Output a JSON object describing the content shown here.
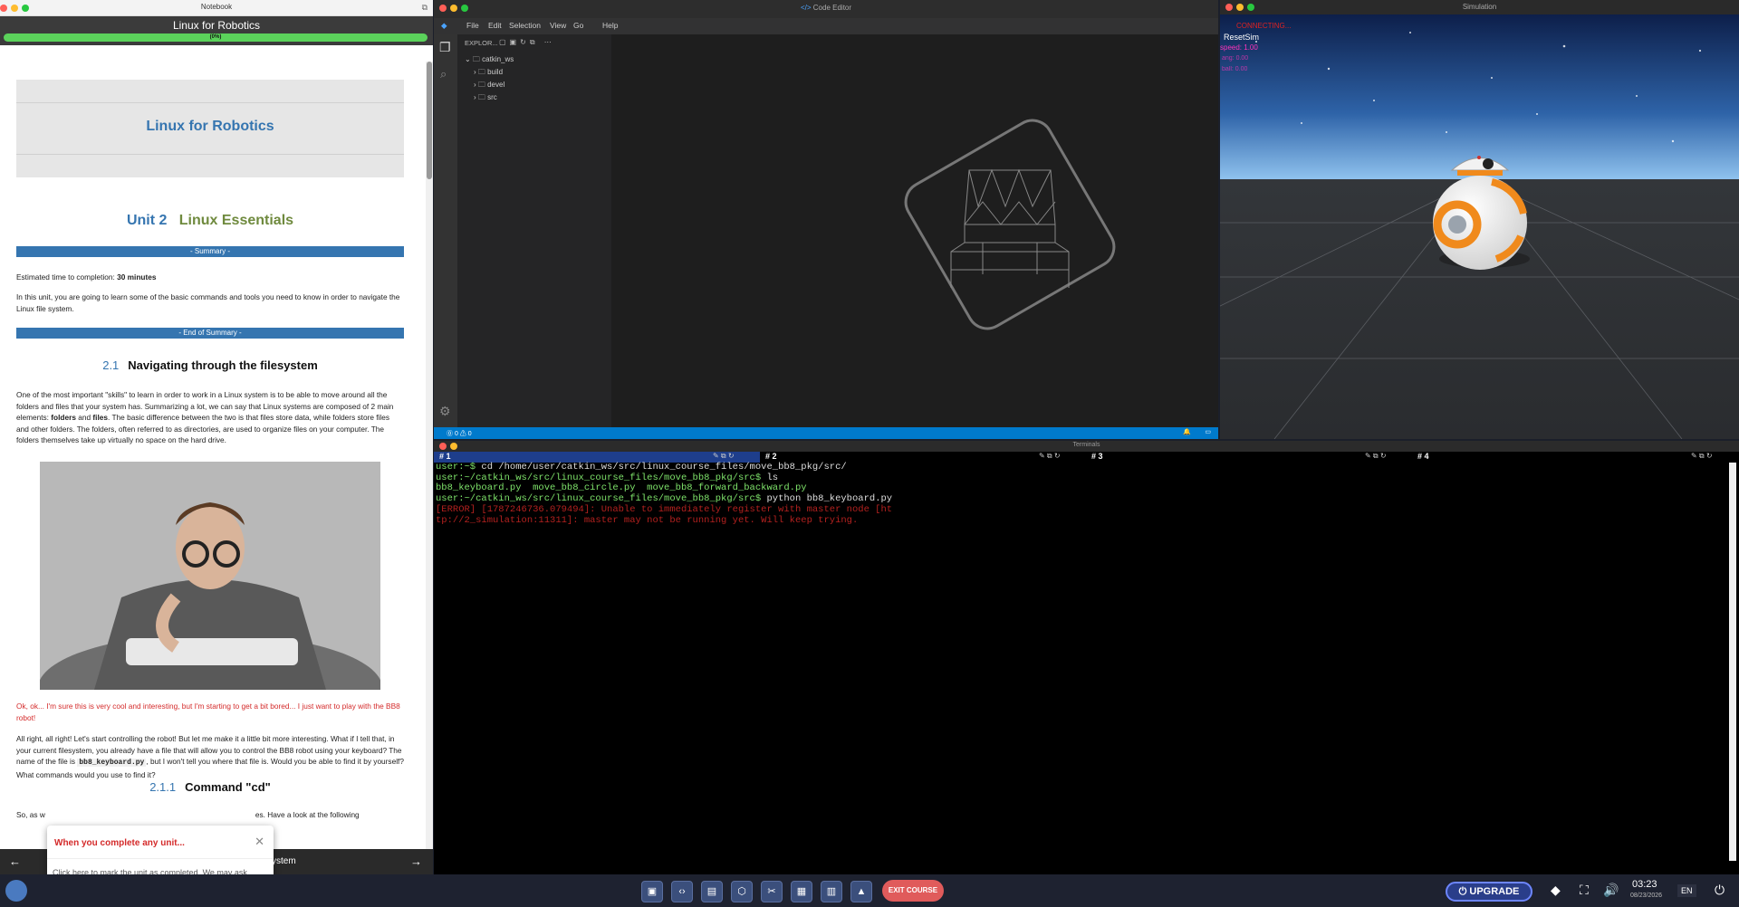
{
  "notebook": {
    "window_title": "Notebook",
    "header_title": "Linux for Robotics",
    "progress_text": "(0%)",
    "progress_value": 0,
    "hero_title": "Linux for Robotics",
    "unit_num": "Unit 2",
    "unit_name": "Linux Essentials",
    "summary_bar": "- Summary -",
    "estimated_label": "Estimated time to completion: ",
    "estimated_value": "30 minutes",
    "intro": "In this unit, you are going to learn some of the basic commands and tools you need to know in order to navigate the Linux file system.",
    "end_summary_bar": "- End of Summary -",
    "section_num": "2.1",
    "section_title": "Navigating through the filesystem",
    "para1_a": "One of the most important \"skills\" to learn in order to work in a Linux system is to be able to move around all the folders and files that your system has. Summarizing a lot, we can say that Linux systems are composed of 2 main elements: ",
    "para1_folders": "folders",
    "para1_and": " and ",
    "para1_files": "files",
    "para1_b": ". The basic difference between the two is that files store data, while folders store files and other folders. The folders, often referred to as directories, are used to organize files on your computer. The folders themselves take up virtually no space on the hard drive.",
    "red_note": "Ok, ok... I'm sure this is very cool and interesting, but I'm starting to get a bit bored... I just want to play with the BB8 robot!",
    "para2_a": "All right, all right! Let's start controlling the robot! But let me make it a little bit more interesting. What if I tell that, in your current filesystem, you already have a file that will allow you to control the BB8 robot using your keyboard? The name of the file is ",
    "para2_code": "bb8_keyboard.py",
    "para2_b": ", but I won't tell you where that file is. Would you be able to find it by yourself? What commands would you use to find it?",
    "subsection_num": "2.1.1",
    "subsection_title": "Command \"cd\"",
    "para3_a": "So, as w",
    "para3_b": "es. Have a look at the following",
    "bottom_nav_text": "ystem"
  },
  "toast": {
    "title": "When you complete any unit...",
    "body": "Click here to mark the unit as completed. We may ask you to take a knowledge check first."
  },
  "editor": {
    "window_title": "Code Editor",
    "menu": [
      "File",
      "Edit",
      "Selection",
      "View",
      "Go",
      "Help"
    ],
    "explorer_label": "EXPLOR...",
    "root_folder": "catkin_ws",
    "folders": [
      "build",
      "devel",
      "src"
    ],
    "status_left": "⓪ 0 ⚠ 0"
  },
  "simulation": {
    "window_title": "Simulation",
    "connecting": "CONNECTING...",
    "reset": "ResetSim",
    "speed": "speed: 1.00",
    "line3": "ang: 0.00",
    "line4": "ball: 0.00"
  },
  "terminal": {
    "window_title": "Terminals",
    "tabs": [
      "# 1",
      "# 2",
      "# 3",
      "# 4"
    ],
    "lines": [
      {
        "prompt": "user:~$",
        "text": " cd /home/user/catkin_ws/src/linux_course_files/move_bb8_pkg/src/"
      },
      {
        "prompt": "user:~/catkin_ws/src/linux_course_files/move_bb8_pkg/src$",
        "text": " ls"
      },
      {
        "files": "bb8_keyboard.py  move_bb8_circle.py  move_bb8_forward_backward.py"
      },
      {
        "prompt": "user:~/catkin_ws/src/linux_course_files/move_bb8_pkg/src$",
        "text": " python bb8_keyboard.py"
      },
      {
        "error": "[ERROR] [1787246736.079494]: Unable to immediately register with master node [ht"
      },
      {
        "error": "tp://2_simulation:11311]: master may not be running yet. Will keep trying."
      }
    ]
  },
  "taskbar": {
    "exit_course": "EXIT COURSE",
    "upgrade": "UPGRADE",
    "time": "03:23",
    "date": "08/23/2026",
    "lang": "EN"
  },
  "colors": {
    "accent_blue": "#3575b0",
    "progress_green": "#5bd25b",
    "error_red": "#d42a2a",
    "exit_red": "#e05b5b",
    "vscode_status": "#007acc"
  }
}
